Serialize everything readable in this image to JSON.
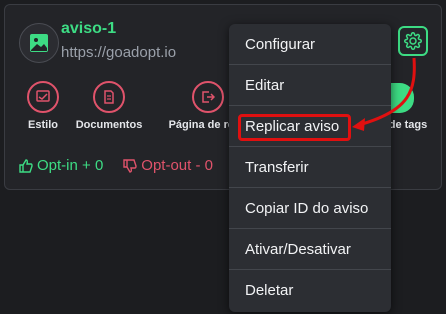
{
  "site": {
    "name": "aviso-1",
    "url": "https://goadopt.io"
  },
  "actions": [
    {
      "label": "Estilo",
      "icon": "style-icon"
    },
    {
      "label": "Documentos",
      "icon": "document-icon"
    },
    {
      "label": "Página de requ",
      "icon": "exit-page-icon"
    },
    {
      "label": "de tags",
      "icon": "tags-icon"
    }
  ],
  "stats": {
    "optin_label": "Opt-in + 0",
    "optout_label": "Opt-out - 0"
  },
  "menu": {
    "items": [
      "Configurar",
      "Editar",
      "Replicar aviso",
      "Transferir",
      "Copiar ID do aviso",
      "Ativar/Desativar",
      "Deletar"
    ]
  },
  "colors": {
    "accent_green": "#3ddc84",
    "accent_red": "#e0536b",
    "annotation_red": "#e01010",
    "background": "#1c1d20"
  }
}
